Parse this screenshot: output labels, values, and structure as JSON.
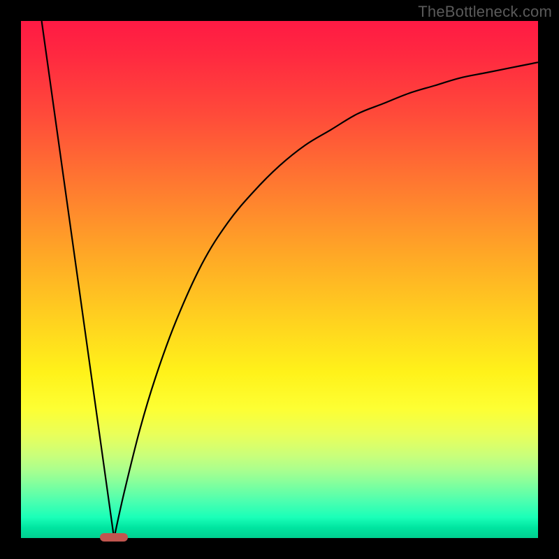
{
  "watermark": "TheBottleneck.com",
  "colors": {
    "frame": "#000000",
    "curve": "#000000",
    "marker": "#c1564f",
    "gradient_top": "#ff1a44",
    "gradient_bottom": "#00d090"
  },
  "chart_data": {
    "type": "line",
    "title": "",
    "xlabel": "",
    "ylabel": "",
    "xlim": [
      0,
      100
    ],
    "ylim": [
      0,
      100
    ],
    "grid": false,
    "legend": false,
    "annotations": [
      {
        "text": "TheBottleneck.com",
        "position": "top-right"
      }
    ],
    "marker": {
      "x": 18,
      "y": 0,
      "color": "#c1564f"
    },
    "series": [
      {
        "name": "left-line",
        "x": [
          4,
          18
        ],
        "y": [
          100,
          0
        ]
      },
      {
        "name": "right-curve",
        "x": [
          18,
          20,
          23,
          26,
          30,
          35,
          40,
          45,
          50,
          55,
          60,
          65,
          70,
          75,
          80,
          85,
          90,
          95,
          100
        ],
        "y": [
          0,
          9,
          21,
          31,
          42,
          53,
          61,
          67,
          72,
          76,
          79,
          82,
          84,
          86,
          87.5,
          89,
          90,
          91,
          92
        ]
      }
    ]
  }
}
